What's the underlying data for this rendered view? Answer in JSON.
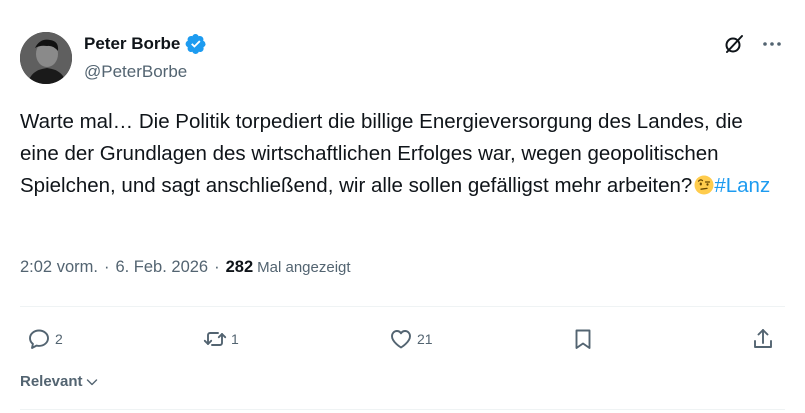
{
  "author": {
    "display_name": "Peter Borbe",
    "handle": "@PeterBorbe",
    "verified": true
  },
  "tweet": {
    "text": "Warte mal… Die Politik torpediert die billige Energieversorgung des Landes, die eine der Grundlagen des wirtschaftlichen Erfolges war, wegen geopolitischen Spielchen, und sagt anschließend, wir alle sollen gefälligst mehr arbeiten?",
    "emoji": "face-with-raised-eyebrow",
    "hashtag": "#Lanz"
  },
  "meta": {
    "time": "2:02 vorm.",
    "separator": "·",
    "date": "6. Feb. 2026",
    "views_count": "282",
    "views_label": "Mal angezeigt"
  },
  "actions": {
    "replies": "2",
    "retweets": "1",
    "likes": "21"
  },
  "sort": {
    "label": "Relevant"
  },
  "colors": {
    "accent": "#1d9bf0",
    "text": "#0f1419",
    "secondary": "#536471",
    "divider": "#eff3f4"
  },
  "icons": [
    "verified-badge-icon",
    "grok-icon",
    "more-icon",
    "reply-icon",
    "retweet-icon",
    "like-icon",
    "bookmark-icon",
    "share-icon",
    "chevron-down-icon"
  ]
}
